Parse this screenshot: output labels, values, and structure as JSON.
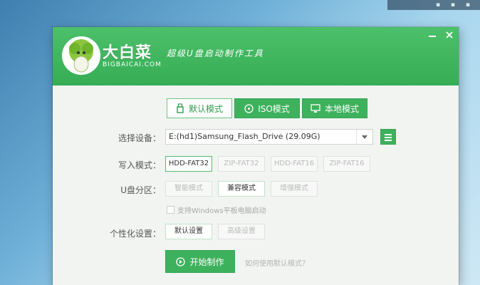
{
  "app": {
    "brand_name": "大白菜",
    "brand_domain": "BIGBAICAI.COM",
    "slogan": "超级U盘启动制作工具",
    "min_symbol": "—",
    "close_symbol": "✕"
  },
  "tabs": [
    {
      "label": "默认模式",
      "icon": "usb-drive-icon",
      "active": true
    },
    {
      "label": "ISO模式",
      "icon": "disc-icon",
      "active": false
    },
    {
      "label": "本地模式",
      "icon": "monitor-icon",
      "active": false
    }
  ],
  "form": {
    "device_label": "选择设备：",
    "device_value": "E:(hd1)Samsung_Flash_Drive (29.09G)",
    "write_mode_label": "写入模式：",
    "write_modes": [
      "HDD-FAT32",
      "ZIP-FAT32",
      "HDD-FAT16",
      "ZIP-FAT16"
    ],
    "partition_label": "U盘分区：",
    "partitions": [
      "智能模式",
      "兼容模式",
      "增强模式"
    ],
    "checkbox_label": "支持Windows平板电脑启动",
    "personalize_label": "个性化设置：",
    "personalize_options": [
      "默认设置",
      "高级设置"
    ]
  },
  "actions": {
    "start_label": "开始制作",
    "help_link": "如何使用默认模式？"
  },
  "colors": {
    "accent_green": "#3eb15d",
    "header_green": "#4cc06a"
  }
}
